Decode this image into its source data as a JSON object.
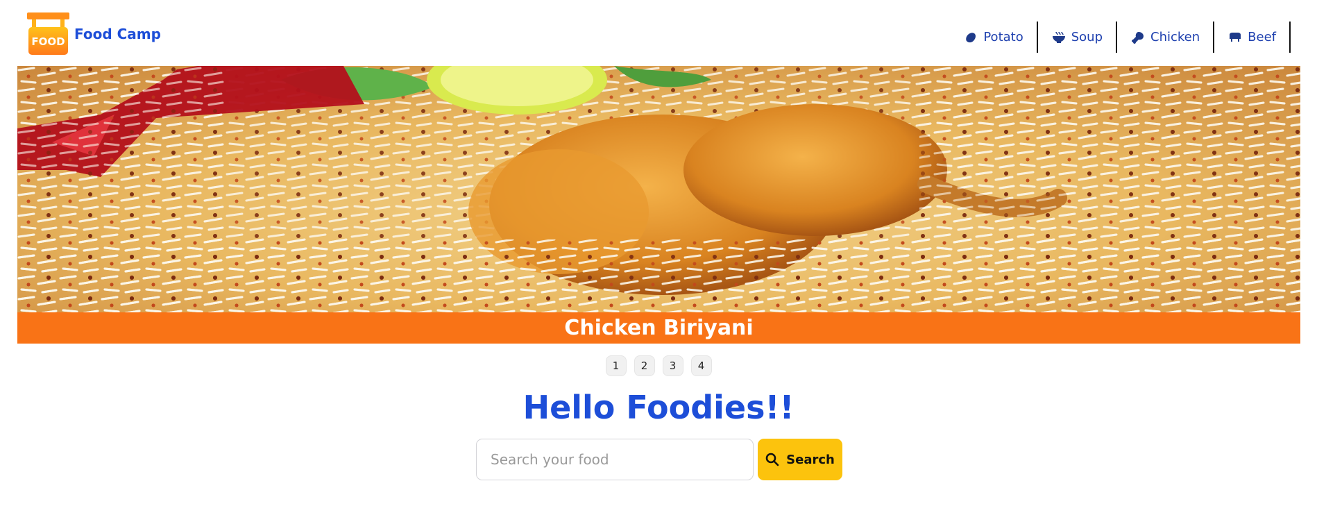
{
  "brand": {
    "logo_badge": "FOOD",
    "name": "Food Camp"
  },
  "nav": {
    "items": [
      {
        "label": "Potato",
        "icon": "potato-icon"
      },
      {
        "label": "Soup",
        "icon": "soup-bowl-icon"
      },
      {
        "label": "Chicken",
        "icon": "drumstick-icon"
      },
      {
        "label": "Beef",
        "icon": "cow-icon"
      }
    ]
  },
  "slider": {
    "caption": "Chicken Biriyani",
    "image": "chicken-biriyani-photo",
    "pages": [
      "1",
      "2",
      "3",
      "4"
    ]
  },
  "hero": {
    "greeting": "Hello Foodies!!"
  },
  "search": {
    "placeholder": "Search your food",
    "button_label": "Search",
    "icon": "search-icon"
  },
  "colors": {
    "brand_blue": "#1d4ed8",
    "caption_orange": "#f97316",
    "search_yellow": "#fcc30d",
    "logo_orange": "#f59e0b"
  }
}
